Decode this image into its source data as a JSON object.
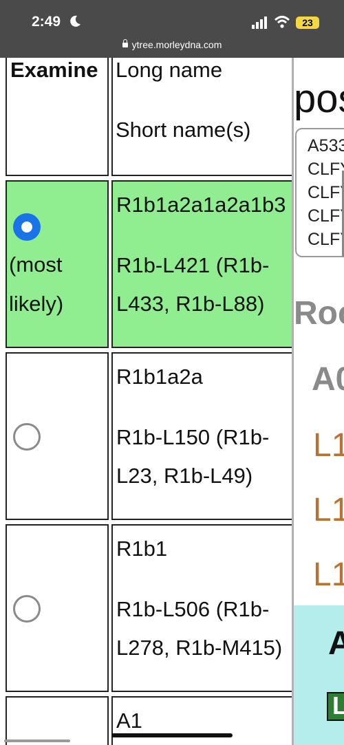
{
  "status_bar": {
    "time": "2:49",
    "battery": "23",
    "url": "ytree.morleydna.com"
  },
  "table": {
    "headers": {
      "examine": "Examine",
      "long_name": "Long name",
      "short_names": "Short name(s)"
    },
    "rows": [
      {
        "selected": true,
        "highlight": true,
        "examine_note_1": "(most",
        "examine_note_2": "likely)",
        "long": "R1b1a2a1a2a1b3",
        "short_1": "R1b-L421 (R1b-",
        "short_2": "L433, R1b-L88)"
      },
      {
        "selected": false,
        "highlight": false,
        "examine_note_1": "",
        "examine_note_2": "",
        "long": "R1b1a2a",
        "short_1": "R1b-L150 (R1b-",
        "short_2": "L23, R1b-L49)"
      },
      {
        "selected": false,
        "highlight": false,
        "examine_note_1": "",
        "examine_note_2": "",
        "long": "R1b1",
        "short_1": "R1b-L506 (R1b-",
        "short_2": "L278, R1b-M415)"
      },
      {
        "selected": false,
        "highlight": false,
        "examine_note_1": "",
        "examine_note_2": "",
        "long": "A1",
        "short_1": "",
        "short_2": ""
      }
    ]
  },
  "right_panel": {
    "heading": "pos",
    "options": [
      "A533",
      "CLFY",
      "CLFY",
      "CLFY",
      "CLFY"
    ],
    "roc_heading": "Roc",
    "ao_heading": "A0",
    "l1_items": [
      "L1",
      "L1",
      "L1"
    ],
    "cyan_heading": "A",
    "badge_letter": "L"
  },
  "colors": {
    "highlight": "#90ee90",
    "radio_selected": "#1a73e8",
    "link_brown": "#b87333",
    "cyan": "#b5ecec"
  }
}
